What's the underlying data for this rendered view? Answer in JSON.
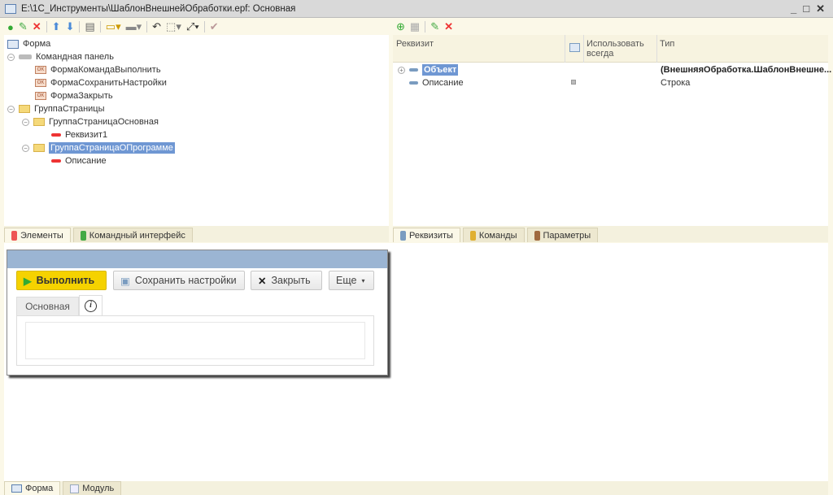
{
  "window": {
    "title": "E:\\1С_Инструменты\\ШаблонВнешнейОбработки.epf: Основная",
    "minimize": "_",
    "maximize": "□",
    "close": "✕"
  },
  "tree": {
    "root": "Форма",
    "command_panel": "Командная панель",
    "commands": [
      "ФормаКомандаВыполнить",
      "ФормаСохранитьНастройки",
      "ФормаЗакрыть"
    ],
    "pages_group": "ГруппаСтраницы",
    "page_main": "ГруппаСтраницаОсновная",
    "page_main_attr": "Реквизит1",
    "page_about": "ГруппаСтраницаОПрограмме",
    "page_about_attr": "Описание"
  },
  "left_tabs": [
    "Элементы",
    "Командный интерфейс"
  ],
  "attributes": {
    "columns": [
      "Реквизит",
      "Использовать всегда",
      "Тип"
    ],
    "rows": [
      {
        "name": "Объект",
        "type": "(ВнешняяОбработка.ШаблонВнешне..."
      },
      {
        "name": "Описание",
        "type": "Строка"
      }
    ]
  },
  "right_tabs": [
    "Реквизиты",
    "Команды",
    "Параметры"
  ],
  "preview": {
    "run": "Выполнить",
    "save": "Сохранить настройки",
    "close": "Закрыть",
    "more": "Еще",
    "tab_main": "Основная",
    "info": "i"
  },
  "bottom_tabs": [
    "Форма",
    "Модуль"
  ]
}
